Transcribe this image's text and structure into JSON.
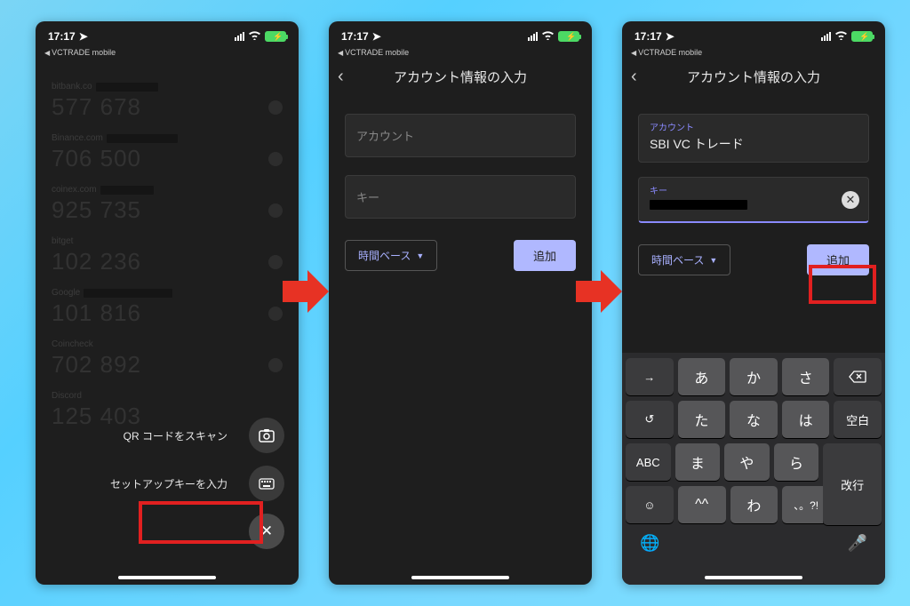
{
  "status": {
    "time": "17:17",
    "breadcrumb": "VCTRADE mobile",
    "wifi": "􀙇",
    "loc": "􀋑"
  },
  "screen1": {
    "fab": {
      "scan_label": "QR コードをスキャン",
      "key_label": "セットアップキーを入力"
    },
    "items": [
      {
        "acct": "bitbank.co",
        "code": "577 678"
      },
      {
        "acct": "Binance.com",
        "code": "706 500"
      },
      {
        "acct": "coinex.com",
        "code": "925 735"
      },
      {
        "acct": "bitget",
        "code": "102 236"
      },
      {
        "acct": "Google",
        "code": "101 816"
      },
      {
        "acct": "Coincheck",
        "code": "702 892"
      },
      {
        "acct": "Discord",
        "code": "125 403"
      }
    ]
  },
  "screen2": {
    "title": "アカウント情報の入力",
    "account_placeholder": "アカウント",
    "key_placeholder": "キー",
    "dropdown_label": "時間ベース",
    "add_label": "追加"
  },
  "screen3": {
    "title": "アカウント情報の入力",
    "account_label": "アカウント",
    "account_value": "SBI VC トレード",
    "key_label": "キー",
    "dropdown_label": "時間ベース",
    "add_label": "追加",
    "keyboard": {
      "row1": [
        "→",
        "あ",
        "か",
        "さ",
        "⌫"
      ],
      "row2": [
        "↺",
        "た",
        "な",
        "は",
        "空白"
      ],
      "row3": [
        "ABC",
        "ま",
        "や",
        "ら",
        "改行"
      ],
      "row4": [
        "☺",
        "^^",
        "わ",
        "、。?!",
        ""
      ]
    }
  }
}
